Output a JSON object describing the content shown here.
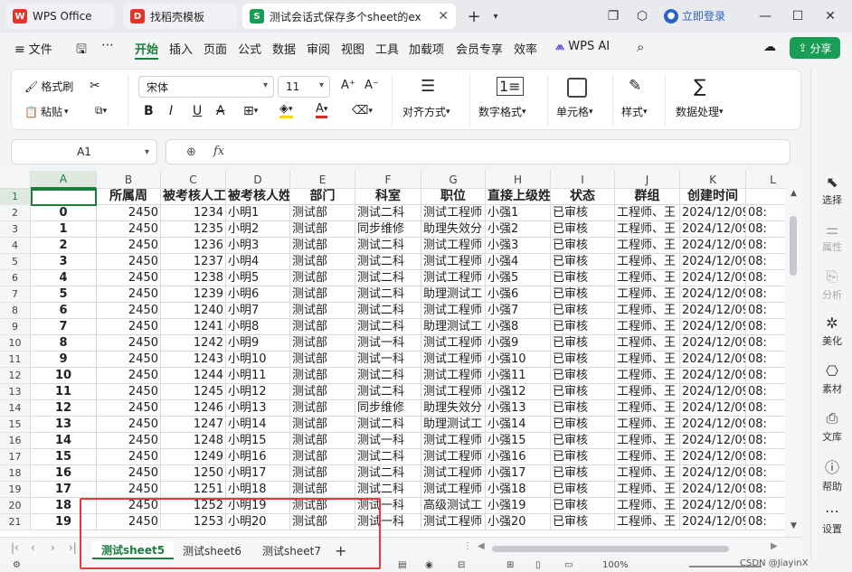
{
  "titlebar": {
    "tabs": [
      {
        "label": "WPS Office",
        "icon": "wps-logo",
        "color": "#e5332a"
      },
      {
        "label": "找稻壳模板",
        "icon": "docer-logo",
        "color": "#e5332a"
      },
      {
        "label": "测试会话式保存多个sheet的ex",
        "icon": "sheet-icon",
        "color": "#1a9e55"
      }
    ],
    "login": "立即登录"
  },
  "menubar": {
    "file": "文件",
    "items": [
      "开始",
      "插入",
      "页面",
      "公式",
      "数据",
      "审阅",
      "视图",
      "工具",
      "加载项",
      "会员专享",
      "效率"
    ],
    "wps_ai": "WPS AI",
    "share": "分享"
  },
  "ribbon": {
    "format_painter": "格式刷",
    "paste": "粘贴",
    "font_name": "宋体",
    "font_size": "11",
    "align": "对齐方式",
    "number_format": "数字格式",
    "cell": "单元格",
    "style": "样式",
    "data_process": "数据处理"
  },
  "formulabar": {
    "name_box": "A1",
    "fx": "fx"
  },
  "grid": {
    "columns": [
      "A",
      "B",
      "C",
      "D",
      "E",
      "F",
      "G",
      "H",
      "I",
      "J",
      "K",
      "L"
    ],
    "header_row": [
      "",
      "所属周",
      "被考核人工号",
      "被考核人姓名",
      "部门",
      "科室",
      "职位",
      "直接上级姓名",
      "状态",
      "群组",
      "创建时间",
      ""
    ],
    "rows": [
      [
        "0",
        "2450",
        "1234",
        "小明1",
        "测试部",
        "测试二科",
        "测试工程师",
        "小强1",
        "已审核",
        "工程师、王",
        "2024/12/09",
        "08:"
      ],
      [
        "1",
        "2450",
        "1235",
        "小明2",
        "测试部",
        "同步维修",
        "助理失效分",
        "小强2",
        "已审核",
        "工程师、王",
        "2024/12/09",
        "08:"
      ],
      [
        "2",
        "2450",
        "1236",
        "小明3",
        "测试部",
        "测试二科",
        "测试工程师",
        "小强3",
        "已审核",
        "工程师、王",
        "2024/12/09",
        "08:"
      ],
      [
        "3",
        "2450",
        "1237",
        "小明4",
        "测试部",
        "测试二科",
        "测试工程师",
        "小强4",
        "已审核",
        "工程师、王",
        "2024/12/09",
        "08:"
      ],
      [
        "4",
        "2450",
        "1238",
        "小明5",
        "测试部",
        "测试二科",
        "测试工程师",
        "小强5",
        "已审核",
        "工程师、王",
        "2024/12/09",
        "08:"
      ],
      [
        "5",
        "2450",
        "1239",
        "小明6",
        "测试部",
        "测试二科",
        "助理测试工",
        "小强6",
        "已审核",
        "工程师、王",
        "2024/12/09",
        "08:"
      ],
      [
        "6",
        "2450",
        "1240",
        "小明7",
        "测试部",
        "测试二科",
        "测试工程师",
        "小强7",
        "已审核",
        "工程师、王",
        "2024/12/09",
        "08:"
      ],
      [
        "7",
        "2450",
        "1241",
        "小明8",
        "测试部",
        "测试二科",
        "助理测试工",
        "小强8",
        "已审核",
        "工程师、王",
        "2024/12/09",
        "08:"
      ],
      [
        "8",
        "2450",
        "1242",
        "小明9",
        "测试部",
        "测试一科",
        "测试工程师",
        "小强9",
        "已审核",
        "工程师、王",
        "2024/12/09",
        "08:"
      ],
      [
        "9",
        "2450",
        "1243",
        "小明10",
        "测试部",
        "测试一科",
        "测试工程师",
        "小强10",
        "已审核",
        "工程师、王",
        "2024/12/09",
        "08:"
      ],
      [
        "10",
        "2450",
        "1244",
        "小明11",
        "测试部",
        "测试二科",
        "测试工程师",
        "小强11",
        "已审核",
        "工程师、王",
        "2024/12/09",
        "08:"
      ],
      [
        "11",
        "2450",
        "1245",
        "小明12",
        "测试部",
        "测试二科",
        "测试工程师",
        "小强12",
        "已审核",
        "工程师、王",
        "2024/12/09",
        "08:"
      ],
      [
        "12",
        "2450",
        "1246",
        "小明13",
        "测试部",
        "同步维修",
        "助理失效分",
        "小强13",
        "已审核",
        "工程师、王",
        "2024/12/09",
        "08:"
      ],
      [
        "13",
        "2450",
        "1247",
        "小明14",
        "测试部",
        "测试二科",
        "助理测试工",
        "小强14",
        "已审核",
        "工程师、王",
        "2024/12/09",
        "08:"
      ],
      [
        "14",
        "2450",
        "1248",
        "小明15",
        "测试部",
        "测试一科",
        "测试工程师",
        "小强15",
        "已审核",
        "工程师、王",
        "2024/12/09",
        "08:"
      ],
      [
        "15",
        "2450",
        "1249",
        "小明16",
        "测试部",
        "测试二科",
        "测试工程师",
        "小强16",
        "已审核",
        "工程师、王",
        "2024/12/09",
        "08:"
      ],
      [
        "16",
        "2450",
        "1250",
        "小明17",
        "测试部",
        "测试二科",
        "测试工程师",
        "小强17",
        "已审核",
        "工程师、王",
        "2024/12/09",
        "08:"
      ],
      [
        "17",
        "2450",
        "1251",
        "小明18",
        "测试部",
        "测试二科",
        "测试工程师",
        "小强18",
        "已审核",
        "工程师、王",
        "2024/12/09",
        "08:"
      ],
      [
        "18",
        "2450",
        "1252",
        "小明19",
        "测试部",
        "测试一科",
        "高级测试工",
        "小强19",
        "已审核",
        "工程师、王",
        "2024/12/09",
        "08:"
      ],
      [
        "19",
        "2450",
        "1253",
        "小明20",
        "测试部",
        "测试一科",
        "测试工程师",
        "小强20",
        "已审核",
        "工程师、王",
        "2024/12/09",
        "08:"
      ]
    ]
  },
  "sheets": {
    "tabs": [
      "测试sheet5",
      "测试sheet6",
      "测试sheet7"
    ],
    "add": "+"
  },
  "statusbar": {
    "zoom": "100%",
    "watermark": "CSDN @JiayinX"
  },
  "rightpanel": {
    "items": [
      "选择",
      "属性",
      "分析",
      "美化",
      "素材",
      "文库",
      "帮助",
      "设置"
    ]
  },
  "colors": {
    "accent": "#1a7f3c",
    "highlight_box": "#e23b3b"
  }
}
